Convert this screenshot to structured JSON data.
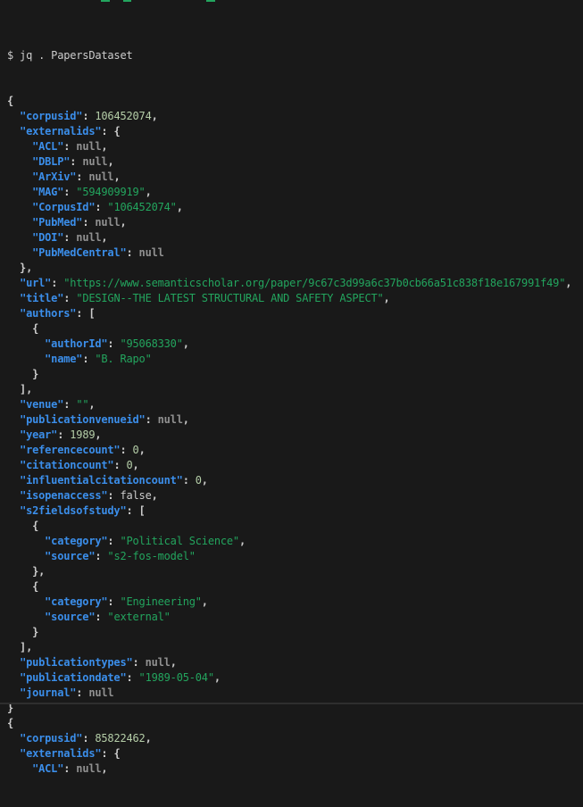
{
  "terminal": {
    "command": "$ jq . PapersDataset",
    "palette": {
      "background": "#191919",
      "key": "#3b8eea",
      "string": "#23a55e",
      "number": "#b5cea8",
      "null_value": "#909090",
      "plain": "#cccccc"
    },
    "lines": [
      [
        [
          "p",
          "{"
        ]
      ],
      [
        [
          "p",
          "  "
        ],
        [
          "k",
          "\"corpusid\""
        ],
        [
          "p",
          ": "
        ],
        [
          "n",
          "106452074"
        ],
        [
          "p",
          ","
        ]
      ],
      [
        [
          "p",
          "  "
        ],
        [
          "k",
          "\"externalids\""
        ],
        [
          "p",
          ": {"
        ]
      ],
      [
        [
          "p",
          "    "
        ],
        [
          "k",
          "\"ACL\""
        ],
        [
          "p",
          ": "
        ],
        [
          "u",
          "null"
        ],
        [
          "p",
          ","
        ]
      ],
      [
        [
          "p",
          "    "
        ],
        [
          "k",
          "\"DBLP\""
        ],
        [
          "p",
          ": "
        ],
        [
          "u",
          "null"
        ],
        [
          "p",
          ","
        ]
      ],
      [
        [
          "p",
          "    "
        ],
        [
          "k",
          "\"ArXiv\""
        ],
        [
          "p",
          ": "
        ],
        [
          "u",
          "null"
        ],
        [
          "p",
          ","
        ]
      ],
      [
        [
          "p",
          "    "
        ],
        [
          "k",
          "\"MAG\""
        ],
        [
          "p",
          ": "
        ],
        [
          "s",
          "\"594909919\""
        ],
        [
          "p",
          ","
        ]
      ],
      [
        [
          "p",
          "    "
        ],
        [
          "k",
          "\"CorpusId\""
        ],
        [
          "p",
          ": "
        ],
        [
          "s",
          "\"106452074\""
        ],
        [
          "p",
          ","
        ]
      ],
      [
        [
          "p",
          "    "
        ],
        [
          "k",
          "\"PubMed\""
        ],
        [
          "p",
          ": "
        ],
        [
          "u",
          "null"
        ],
        [
          "p",
          ","
        ]
      ],
      [
        [
          "p",
          "    "
        ],
        [
          "k",
          "\"DOI\""
        ],
        [
          "p",
          ": "
        ],
        [
          "u",
          "null"
        ],
        [
          "p",
          ","
        ]
      ],
      [
        [
          "p",
          "    "
        ],
        [
          "k",
          "\"PubMedCentral\""
        ],
        [
          "p",
          ": "
        ],
        [
          "u",
          "null"
        ]
      ],
      [
        [
          "p",
          "  },"
        ]
      ],
      [
        [
          "p",
          "  "
        ],
        [
          "k",
          "\"url\""
        ],
        [
          "p",
          ": "
        ],
        [
          "s",
          "\"https://www.semanticscholar.org/paper/9c67c3d99a6c37b0cb66a51c838f18e167991f49\""
        ],
        [
          "p",
          ","
        ]
      ],
      [
        [
          "p",
          "  "
        ],
        [
          "k",
          "\"title\""
        ],
        [
          "p",
          ": "
        ],
        [
          "s",
          "\"DESIGN--THE LATEST STRUCTURAL AND SAFETY ASPECT\""
        ],
        [
          "p",
          ","
        ]
      ],
      [
        [
          "p",
          "  "
        ],
        [
          "k",
          "\"authors\""
        ],
        [
          "p",
          ": ["
        ]
      ],
      [
        [
          "p",
          "    {"
        ]
      ],
      [
        [
          "p",
          "      "
        ],
        [
          "k",
          "\"authorId\""
        ],
        [
          "p",
          ": "
        ],
        [
          "s",
          "\"95068330\""
        ],
        [
          "p",
          ","
        ]
      ],
      [
        [
          "p",
          "      "
        ],
        [
          "k",
          "\"name\""
        ],
        [
          "p",
          ": "
        ],
        [
          "s",
          "\"B. Rapo\""
        ]
      ],
      [
        [
          "p",
          "    }"
        ]
      ],
      [
        [
          "p",
          "  ],"
        ]
      ],
      [
        [
          "p",
          "  "
        ],
        [
          "k",
          "\"venue\""
        ],
        [
          "p",
          ": "
        ],
        [
          "s",
          "\"\""
        ],
        [
          "p",
          ","
        ]
      ],
      [
        [
          "p",
          "  "
        ],
        [
          "k",
          "\"publicationvenueid\""
        ],
        [
          "p",
          ": "
        ],
        [
          "u",
          "null"
        ],
        [
          "p",
          ","
        ]
      ],
      [
        [
          "p",
          "  "
        ],
        [
          "k",
          "\"year\""
        ],
        [
          "p",
          ": "
        ],
        [
          "n",
          "1989"
        ],
        [
          "p",
          ","
        ]
      ],
      [
        [
          "p",
          "  "
        ],
        [
          "k",
          "\"referencecount\""
        ],
        [
          "p",
          ": "
        ],
        [
          "n",
          "0"
        ],
        [
          "p",
          ","
        ]
      ],
      [
        [
          "p",
          "  "
        ],
        [
          "k",
          "\"citationcount\""
        ],
        [
          "p",
          ": "
        ],
        [
          "n",
          "0"
        ],
        [
          "p",
          ","
        ]
      ],
      [
        [
          "p",
          "  "
        ],
        [
          "k",
          "\"influentialcitationcount\""
        ],
        [
          "p",
          ": "
        ],
        [
          "n",
          "0"
        ],
        [
          "p",
          ","
        ]
      ],
      [
        [
          "p",
          "  "
        ],
        [
          "k",
          "\"isopenaccess\""
        ],
        [
          "p",
          ": "
        ],
        [
          "b",
          "false"
        ],
        [
          "p",
          ","
        ]
      ],
      [
        [
          "p",
          "  "
        ],
        [
          "k",
          "\"s2fieldsofstudy\""
        ],
        [
          "p",
          ": ["
        ]
      ],
      [
        [
          "p",
          "    {"
        ]
      ],
      [
        [
          "p",
          "      "
        ],
        [
          "k",
          "\"category\""
        ],
        [
          "p",
          ": "
        ],
        [
          "s",
          "\"Political Science\""
        ],
        [
          "p",
          ","
        ]
      ],
      [
        [
          "p",
          "      "
        ],
        [
          "k",
          "\"source\""
        ],
        [
          "p",
          ": "
        ],
        [
          "s",
          "\"s2-fos-model\""
        ]
      ],
      [
        [
          "p",
          "    },"
        ]
      ],
      [
        [
          "p",
          "    {"
        ]
      ],
      [
        [
          "p",
          "      "
        ],
        [
          "k",
          "\"category\""
        ],
        [
          "p",
          ": "
        ],
        [
          "s",
          "\"Engineering\""
        ],
        [
          "p",
          ","
        ]
      ],
      [
        [
          "p",
          "      "
        ],
        [
          "k",
          "\"source\""
        ],
        [
          "p",
          ": "
        ],
        [
          "s",
          "\"external\""
        ]
      ],
      [
        [
          "p",
          "    }"
        ]
      ],
      [
        [
          "p",
          "  ],"
        ]
      ],
      [
        [
          "p",
          "  "
        ],
        [
          "k",
          "\"publicationtypes\""
        ],
        [
          "p",
          ": "
        ],
        [
          "u",
          "null"
        ],
        [
          "p",
          ","
        ]
      ],
      [
        [
          "p",
          "  "
        ],
        [
          "k",
          "\"publicationdate\""
        ],
        [
          "p",
          ": "
        ],
        [
          "s",
          "\"1989-05-04\""
        ],
        [
          "p",
          ","
        ]
      ],
      [
        [
          "p",
          "  "
        ],
        [
          "k",
          "\"journal\""
        ],
        [
          "p",
          ": "
        ],
        [
          "u",
          "null"
        ]
      ],
      [
        [
          "p",
          "}"
        ]
      ],
      [
        [
          "p",
          "{"
        ]
      ],
      [
        [
          "p",
          "  "
        ],
        [
          "k",
          "\"corpusid\""
        ],
        [
          "p",
          ": "
        ],
        [
          "n",
          "85822462"
        ],
        [
          "p",
          ","
        ]
      ],
      [
        [
          "p",
          "  "
        ],
        [
          "k",
          "\"externalids\""
        ],
        [
          "p",
          ": {"
        ]
      ],
      [
        [
          "p",
          "    "
        ],
        [
          "k",
          "\"ACL\""
        ],
        [
          "p",
          ": "
        ],
        [
          "u",
          "null"
        ],
        [
          "p",
          ","
        ]
      ]
    ]
  }
}
